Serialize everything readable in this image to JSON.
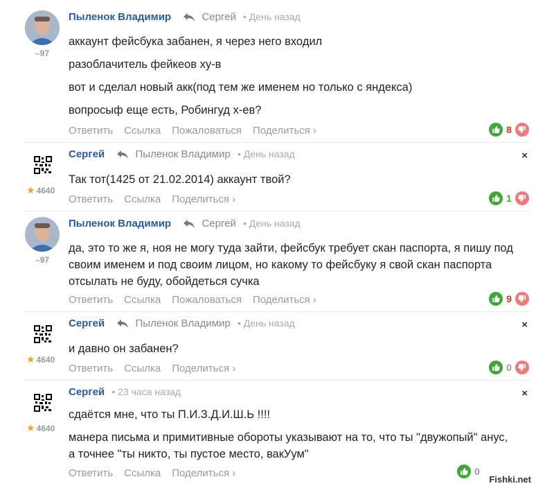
{
  "comments": [
    {
      "author": "Пыленок Владимир",
      "reply_to": "Сергей",
      "time": "• День назад",
      "rating": "–97",
      "lines": [
        "аккаунт фейсбука забанен, я через него входил",
        "разоблачитель фейкеов ху-в",
        "вот и сделал новый акк(под тем же именем но только с яндекса)",
        "вопросыф еще есть, Робингуд х-ев?"
      ],
      "actions": [
        "Ответить",
        "Ссылка",
        "Пожаловаться",
        "Поделиться ›"
      ],
      "score": "8",
      "score_color": "#c0392b"
    },
    {
      "author": "Сергей",
      "reply_to": "Пыленок Владимир",
      "time": "• День назад",
      "rating": "4640",
      "lines": [
        "Так тот(1425 от 21.02.2014) аккаунт твой?"
      ],
      "actions": [
        "Ответить",
        "Ссылка",
        "Поделиться ›"
      ],
      "score": "1",
      "score_color": "#3ea83b",
      "close": "×"
    },
    {
      "author": "Пыленок Владимир",
      "reply_to": "Сергей",
      "time": "• День назад",
      "rating": "–97",
      "lines": [
        "да, это то же я, ноя не могу туда зайти, фейсбук требует скан паспорта, я пишу под",
        "своим именем и под своим лицом, но какому то фейсбуку я свой скан паспорта",
        "отсылать не буду, обойдеться сучка"
      ],
      "actions": [
        "Ответить",
        "Ссылка",
        "Пожаловаться",
        "Поделиться ›"
      ],
      "score": "9",
      "score_color": "#c0392b"
    },
    {
      "author": "Сергей",
      "reply_to": "Пыленок Владимир",
      "time": "• День назад",
      "rating": "4640",
      "lines": [
        "и давно он забанен?"
      ],
      "actions": [
        "Ответить",
        "Ссылка",
        "Поделиться ›"
      ],
      "score": "0",
      "score_color": "#999999",
      "close": "×"
    },
    {
      "author": "Сергей",
      "reply_to": "",
      "time": "• 23 часа назад",
      "rating": "4640",
      "lines": [
        "сдаётся мне, что ты П.И.З.Д.И.Ш.Ь !!!!",
        "манера письма и примитивные обороты указывают на то, что ты \"двужопый\" анус,",
        "а точнее \"ты никто, ты пустое место, вакУум\""
      ],
      "actions": [
        "Ответить",
        "Ссылка",
        "Поделиться ›"
      ],
      "score": "0",
      "score_color": "#999999",
      "close": "×"
    }
  ],
  "watermark": "Fishki.net",
  "colors": {
    "author": "#2b5aa0",
    "up": "#3ea83b",
    "down": "#f07a7a",
    "star": "#f3a11f"
  }
}
